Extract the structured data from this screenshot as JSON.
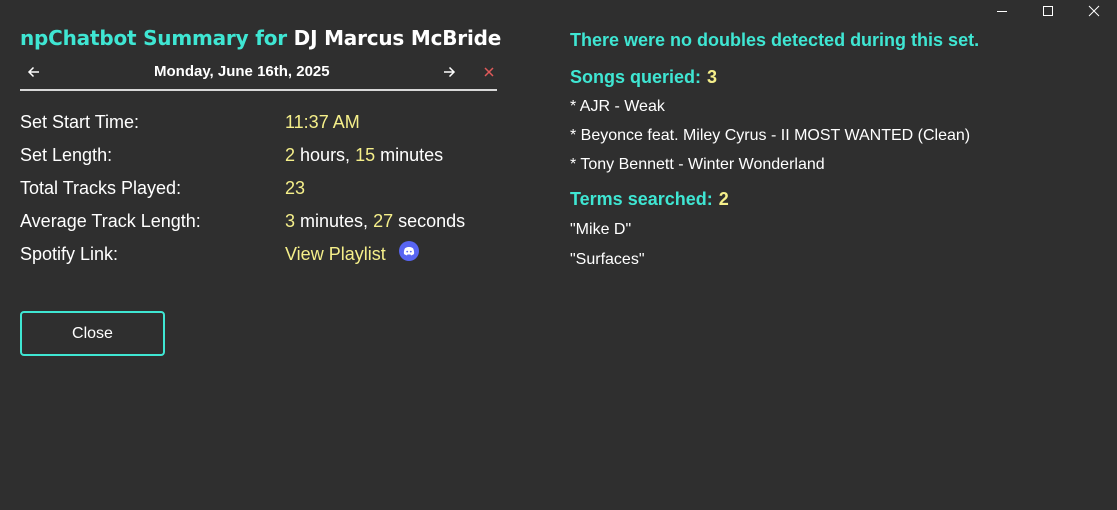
{
  "window_controls": {
    "minimize_icon": "minimize-icon",
    "maximize_icon": "maximize-icon",
    "close_icon": "close-icon"
  },
  "header": {
    "title_prefix": "npChatbot Summary for",
    "dj_name": "DJ Marcus McBride"
  },
  "date_nav": {
    "date": "Monday, June 16th, 2025",
    "prev_icon": "arrow-left-icon",
    "next_icon": "arrow-right-icon",
    "dismiss_icon": "close-icon"
  },
  "stats": {
    "start_time": {
      "label": "Set Start Time:",
      "value": "11:37 AM"
    },
    "set_length": {
      "label": "Set Length:",
      "hours": "2",
      "hours_unit": "hours,",
      "minutes": "15",
      "minutes_unit": "minutes"
    },
    "total_tracks": {
      "label": "Total Tracks Played:",
      "value": "23"
    },
    "avg_track_length": {
      "label": "Average Track Length:",
      "minutes": "3",
      "minutes_unit": "minutes,",
      "seconds": "27",
      "seconds_unit": "seconds"
    },
    "spotify": {
      "label": "Spotify Link:",
      "link_text": "View Playlist",
      "icon": "discord-icon"
    }
  },
  "actions": {
    "close_label": "Close"
  },
  "summary": {
    "doubles_message": "There were no doubles detected during this set.",
    "songs_queried_label": "Songs queried:",
    "songs_queried_count": "3",
    "songs": [
      "* AJR - Weak",
      "* Beyonce feat. Miley Cyrus - II MOST WANTED (Clean)",
      "* Tony Bennett - Winter Wonderland"
    ],
    "terms_searched_label": "Terms searched:",
    "terms_searched_count": "2",
    "terms": [
      "\"Mike D\"",
      "\"Surfaces\""
    ]
  },
  "colors": {
    "background": "#2f2f2f",
    "accent": "#3fe6d3",
    "highlight": "#f5ef8a",
    "danger": "#e05a5a",
    "badge": "#5865f2"
  }
}
